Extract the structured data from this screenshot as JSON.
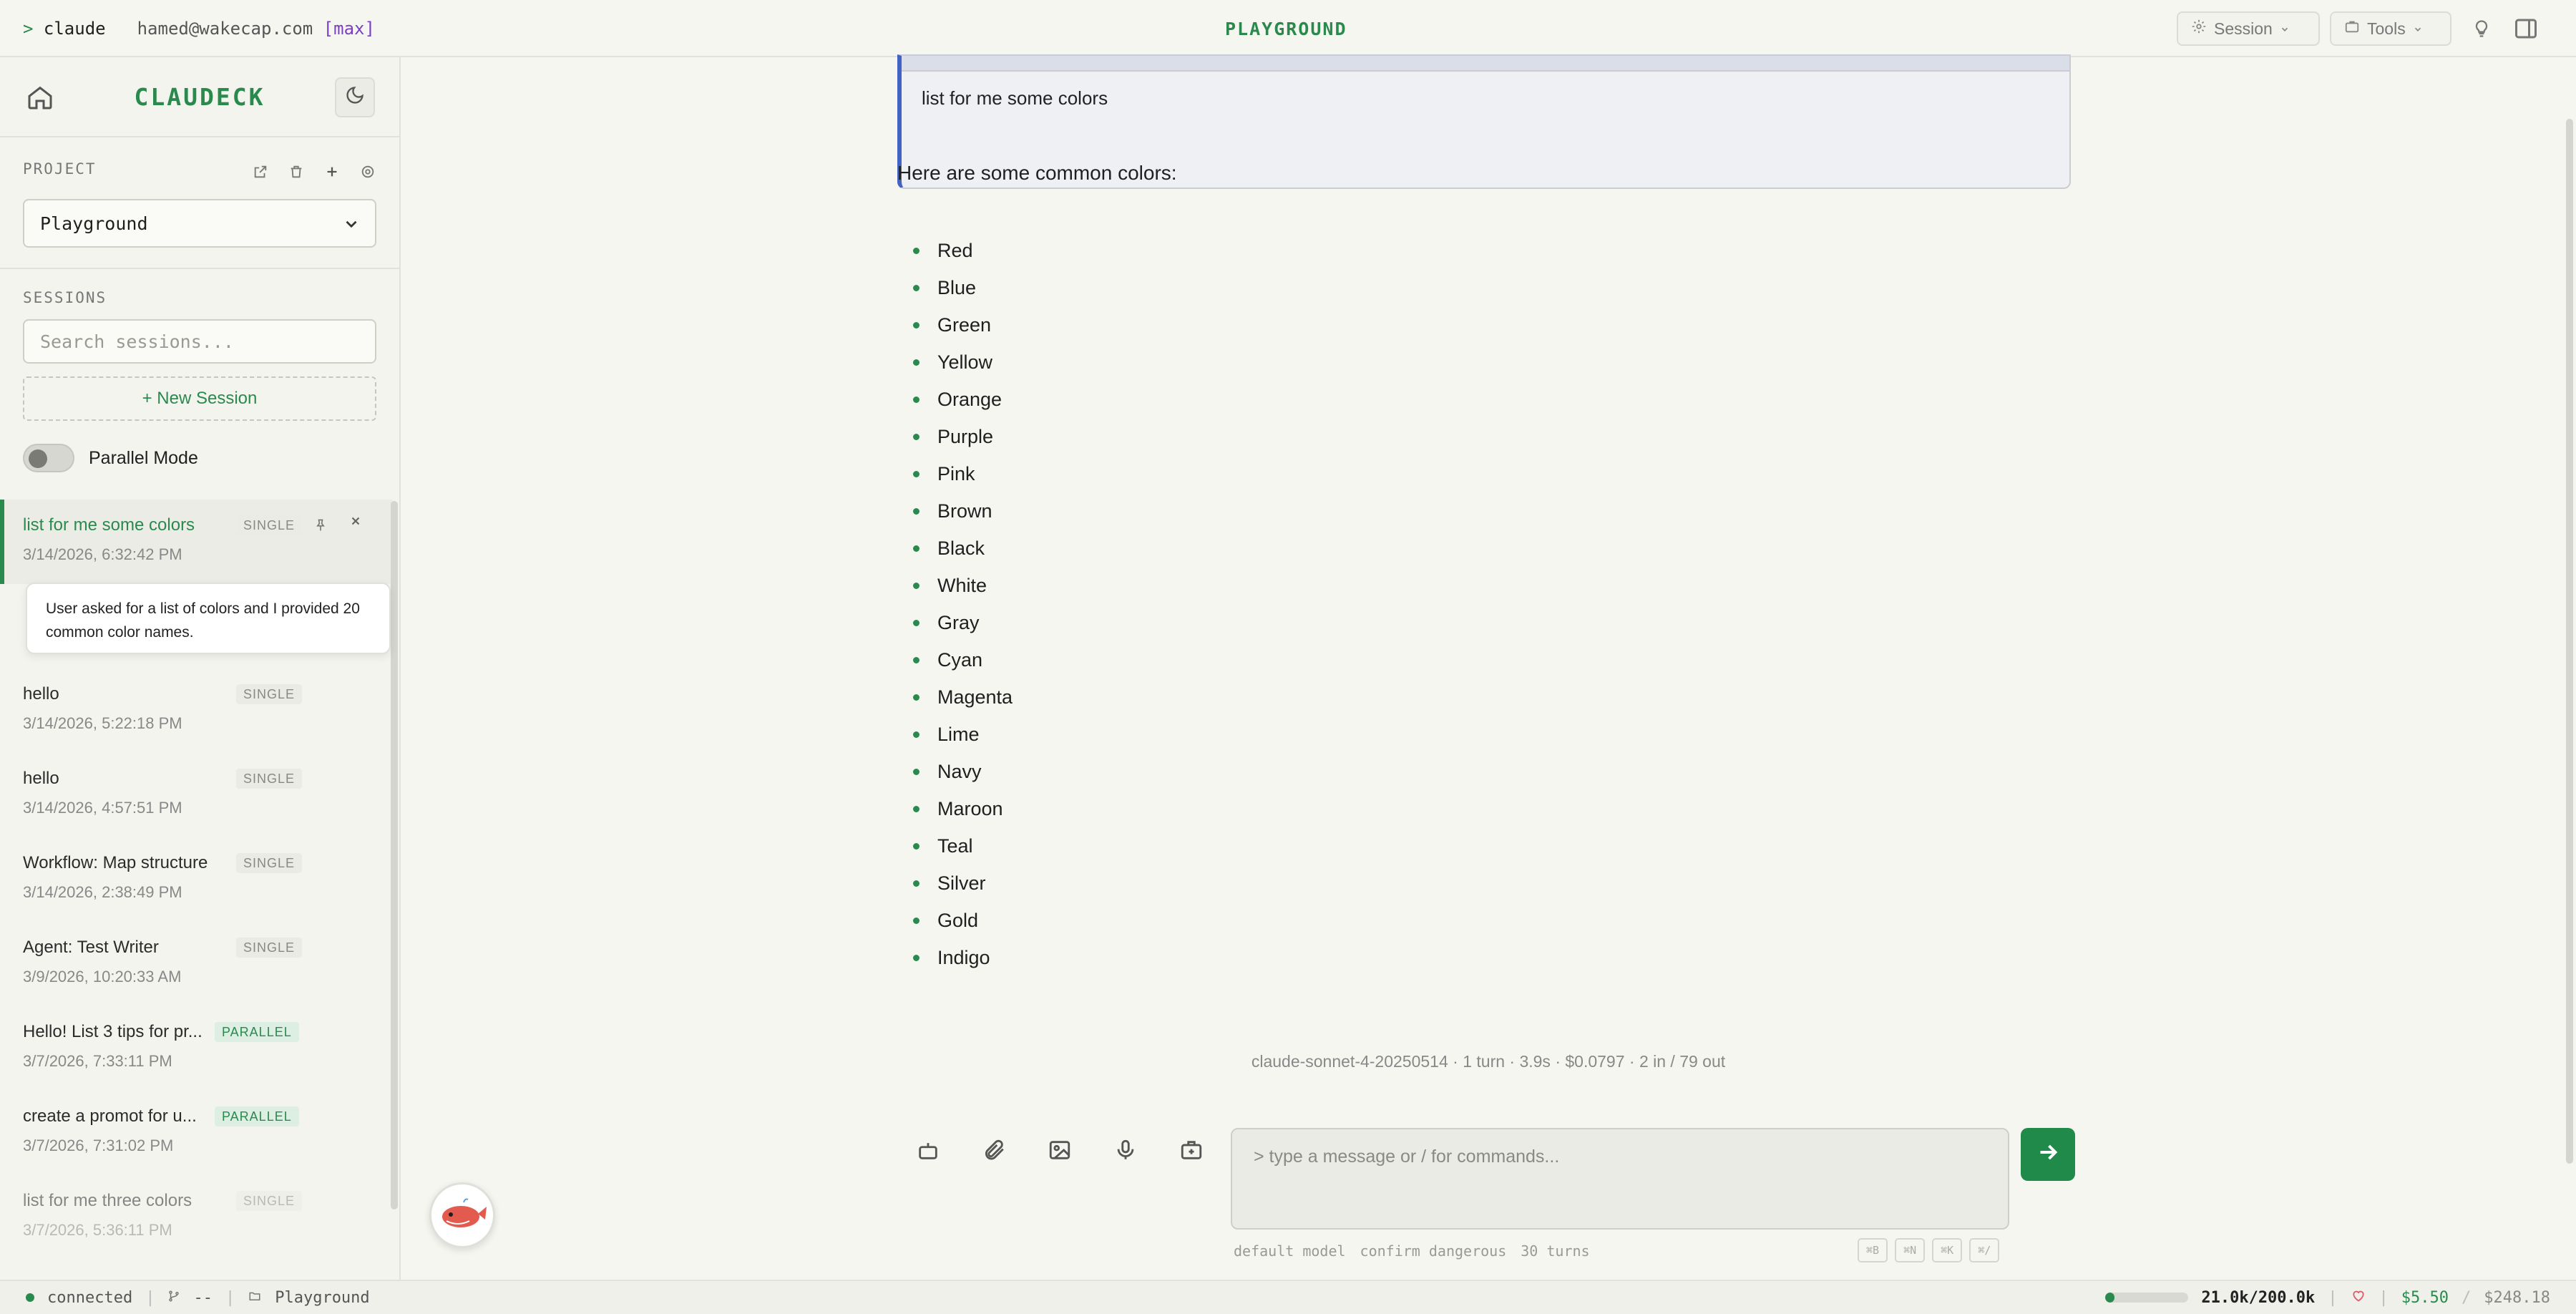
{
  "topbar": {
    "prompt_symbol": ">",
    "app_cmd": "claude",
    "user_email": "hamed@wakecap.com",
    "plan_tag": "[max]",
    "page_title": "PLAYGROUND",
    "session_label": "Session",
    "tools_label": "Tools"
  },
  "sidebar": {
    "brand": "CLAUDECK",
    "project_label": "PROJECT",
    "project_value": "Playground",
    "sessions_label": "SESSIONS",
    "search_placeholder": "Search sessions...",
    "new_session_label": "+ New Session",
    "parallel_mode_label": "Parallel Mode",
    "parallel_mode_on": false,
    "tooltip": "User asked for a list of colors and I provided 20 common color names.",
    "sessions": [
      {
        "name": "list for me some colors",
        "date": "3/14/2026, 6:32:42 PM",
        "badge": "SINGLE",
        "active": true
      },
      {
        "name": "hello",
        "date": "3/14/2026, 5:22:18 PM",
        "badge": "SINGLE"
      },
      {
        "name": "hello",
        "date": "3/14/2026, 4:57:51 PM",
        "badge": "SINGLE"
      },
      {
        "name": "Workflow: Map structure",
        "date": "3/14/2026, 2:38:49 PM",
        "badge": "SINGLE"
      },
      {
        "name": "Agent: Test Writer",
        "date": "3/9/2026, 10:20:33 AM",
        "badge": "SINGLE"
      },
      {
        "name": "Hello! List 3 tips for pr...",
        "date": "3/7/2026, 7:33:11 PM",
        "badge": "PARALLEL"
      },
      {
        "name": "create a promot for u...",
        "date": "3/7/2026, 7:31:02 PM",
        "badge": "PARALLEL"
      },
      {
        "name": "list for me three colors",
        "date": "3/7/2026, 5:36:11 PM",
        "badge": "SINGLE"
      }
    ]
  },
  "chat": {
    "user_message": "list for me some colors",
    "answer_intro": "Here are some common colors:",
    "colors": [
      "Red",
      "Blue",
      "Green",
      "Yellow",
      "Orange",
      "Purple",
      "Pink",
      "Brown",
      "Black",
      "White",
      "Gray",
      "Cyan",
      "Magenta",
      "Lime",
      "Navy",
      "Maroon",
      "Teal",
      "Silver",
      "Gold",
      "Indigo"
    ],
    "meta": "claude-sonnet-4-20250514 · 1 turn · 3.9s · $0.0797 · 2 in / 79 out"
  },
  "input": {
    "placeholder": "> type a message or / for commands...",
    "model": "default model",
    "confirm": "confirm dangerous",
    "turns": "30 turns",
    "shortcuts": [
      "⌘B",
      "⌘N",
      "⌘K",
      "⌘/"
    ]
  },
  "statusbar": {
    "connection": "connected",
    "branch": "--",
    "folder": "Playground",
    "context_usage": "21.0k/200.0k",
    "context_fraction": 0.105,
    "session_cost": "$5.50",
    "total_cost": "$248.18"
  },
  "colors": {
    "accent": "#2a8a4e",
    "quote_border": "#4263c4",
    "plan_tag": "#7a3fc7"
  }
}
